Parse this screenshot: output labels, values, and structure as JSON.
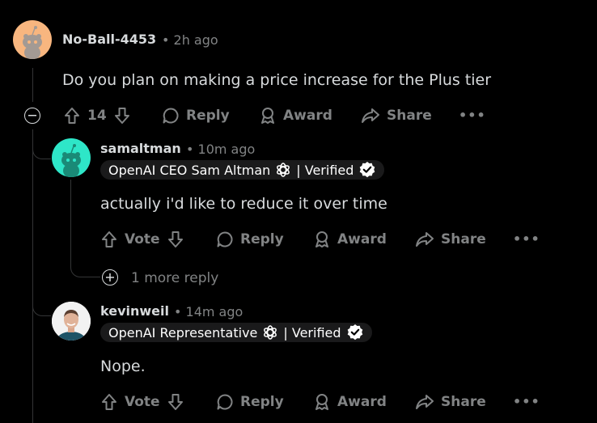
{
  "comment1": {
    "username": "No-Ball-4453",
    "time": "• 2h ago",
    "body": "Do you plan on making a price increase for the Plus tier",
    "votes": "14",
    "reply_label": "Reply",
    "award_label": "Award",
    "share_label": "Share",
    "more_label": "•••"
  },
  "comment2": {
    "username": "samaltman",
    "time": "• 10m ago",
    "flair_text": "OpenAI CEO Sam Altman",
    "flair_verified": "| Verified",
    "body": "actually i'd like to reduce it over time",
    "vote_label": "Vote",
    "reply_label": "Reply",
    "award_label": "Award",
    "share_label": "Share",
    "more_label": "•••",
    "more_replies": "1 more reply"
  },
  "comment3": {
    "username": "kevinweil",
    "time": "• 14m ago",
    "flair_text": "OpenAI Representative",
    "flair_verified": "| Verified",
    "body": "Nope.",
    "vote_label": "Vote",
    "reply_label": "Reply",
    "award_label": "Award",
    "share_label": "Share",
    "more_label": "•••"
  },
  "colors": {
    "background": "#000000",
    "text": "#d7dadc",
    "muted": "#818384",
    "thread_line": "#343536",
    "avatar1": "#f8b67f",
    "avatar2": "#2ee6c8"
  }
}
